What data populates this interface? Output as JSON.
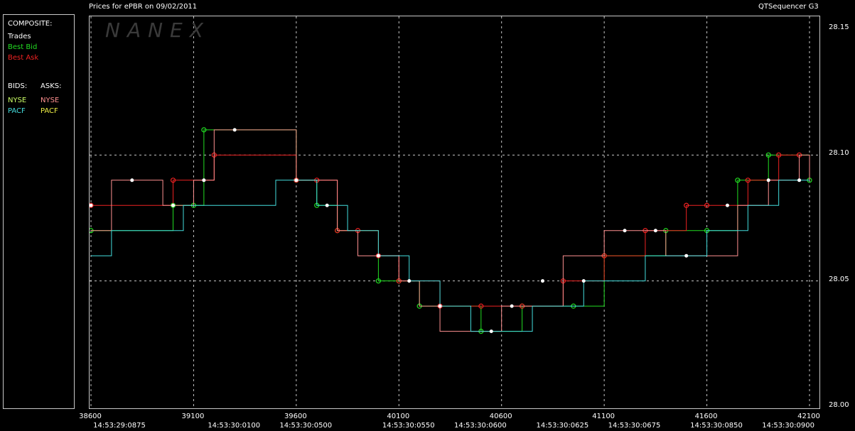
{
  "header": {
    "title": "Prices for  ePBR  on  09/02/2011",
    "app": "QTSequencer G3"
  },
  "watermark": "NANEX",
  "legend": {
    "composite_label": "COMPOSITE:",
    "trades": "Trades",
    "best_bid": "Best Bid",
    "best_ask": "Best Ask",
    "bids_label": "BIDS:",
    "asks_label": "ASKS:",
    "bid_nyse": "NYSE",
    "bid_pacf": "PACF",
    "ask_nyse": "NYSE",
    "ask_pacf": "PACF"
  },
  "colors": {
    "trades": "#ffffff",
    "best_bid": "#22dd22",
    "best_ask": "#ee2222",
    "bid_nyse": "#ccff66",
    "bid_pacf": "#44dddd",
    "ask_nyse": "#ff9090",
    "ask_pacf": "#eeee44",
    "grid": "#c8c8c8"
  },
  "chart_data": {
    "type": "line",
    "ylim": [
      28.0,
      28.15
    ],
    "xlim": [
      38600,
      42100
    ],
    "y_ticks": [
      "28.15",
      "28.10",
      "28.05",
      "28.00"
    ],
    "x_ticks": [
      "38600",
      "39100",
      "39600",
      "40100",
      "40600",
      "41100",
      "41600",
      "42100"
    ],
    "time_labels": [
      "14:53:29:0875",
      "14:53:30:0100",
      "14:53:30:0500",
      "14:53:30:0550",
      "14:53:30:0600",
      "14:53:30:0625",
      "14:53:30:0675",
      "14:53:30:0850",
      "14:53:30:0900"
    ],
    "grid": true,
    "series": [
      {
        "name": "Best Bid",
        "x": [
          38600,
          39000,
          39100,
          39150,
          39600,
          39700,
          39800,
          40000,
          40100,
          40200,
          40500,
          40700,
          40950,
          41100,
          41400,
          41600,
          41750,
          41900,
          42100
        ],
        "y": [
          28.07,
          28.08,
          28.08,
          28.11,
          28.09,
          28.08,
          28.07,
          28.05,
          28.05,
          28.04,
          28.03,
          28.04,
          28.04,
          28.06,
          28.07,
          28.07,
          28.09,
          28.1,
          28.09
        ]
      },
      {
        "name": "Best Ask",
        "x": [
          38600,
          39000,
          39200,
          39600,
          39700,
          39800,
          39900,
          40000,
          40100,
          40300,
          40500,
          40700,
          40900,
          41100,
          41300,
          41500,
          41600,
          41800,
          41950,
          42050
        ],
        "y": [
          28.08,
          28.09,
          28.1,
          28.09,
          28.09,
          28.07,
          28.07,
          28.06,
          28.05,
          28.04,
          28.04,
          28.04,
          28.05,
          28.06,
          28.07,
          28.08,
          28.08,
          28.09,
          28.1,
          28.1
        ]
      },
      {
        "name": "NYSE",
        "x": [
          38600,
          38700,
          38850,
          38950,
          39100,
          39200,
          39350,
          39500,
          39600,
          39800,
          39900,
          40000,
          40100,
          40200,
          40300,
          40400,
          40600,
          40750,
          40900,
          41100,
          41250,
          41400,
          41600,
          41750,
          41900,
          42050,
          42100
        ],
        "y": [
          28.07,
          28.09,
          28.09,
          28.08,
          28.09,
          28.11,
          28.11,
          28.11,
          28.09,
          28.07,
          28.06,
          28.06,
          28.05,
          28.04,
          28.03,
          28.03,
          28.04,
          28.04,
          28.06,
          28.07,
          28.07,
          28.06,
          28.06,
          28.08,
          28.09,
          28.1,
          28.09
        ]
      },
      {
        "name": "PACF",
        "x": [
          38600,
          38700,
          38900,
          39050,
          39200,
          39350,
          39500,
          39600,
          39700,
          39850,
          40000,
          40150,
          40300,
          40450,
          40600,
          40750,
          40850,
          41000,
          41150,
          41300,
          41450,
          41600,
          41800,
          41950,
          42100
        ],
        "y": [
          28.06,
          28.07,
          28.07,
          28.08,
          28.08,
          28.08,
          28.09,
          28.09,
          28.08,
          28.07,
          28.06,
          28.05,
          28.04,
          28.03,
          28.03,
          28.04,
          28.04,
          28.05,
          28.05,
          28.06,
          28.06,
          28.07,
          28.08,
          28.09,
          28.09
        ]
      },
      {
        "name": "Trades",
        "x": [
          38600,
          38800,
          39000,
          39150,
          39300,
          39600,
          39750,
          40000,
          40150,
          40300,
          40550,
          40650,
          40800,
          41000,
          41200,
          41350,
          41500,
          41700,
          41900,
          42050
        ],
        "y": [
          28.08,
          28.09,
          28.08,
          28.09,
          28.11,
          28.09,
          28.08,
          28.06,
          28.05,
          28.04,
          28.03,
          28.04,
          28.05,
          28.05,
          28.07,
          28.07,
          28.06,
          28.08,
          28.09,
          28.09
        ]
      }
    ]
  }
}
